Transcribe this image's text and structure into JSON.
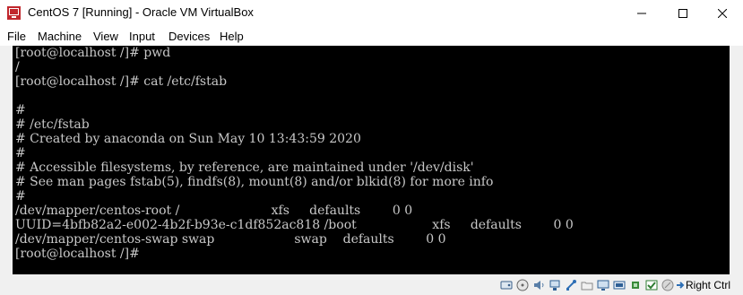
{
  "window": {
    "title": "CentOS 7 [Running] - Oracle VM VirtualBox"
  },
  "menu": [
    "File",
    "Machine",
    "View",
    "Input",
    "Devices",
    "Help"
  ],
  "console_lines": [
    "[root@localhost /]# pwd",
    "/",
    "[root@localhost /]# cat /etc/fstab",
    "",
    "#",
    "# /etc/fstab",
    "# Created by anaconda on Sun May 10 13:43:59 2020",
    "#",
    "# Accessible filesystems, by reference, are maintained under '/dev/disk'",
    "# See man pages fstab(5), findfs(8), mount(8) and/or blkid(8) for more info",
    "#",
    "/dev/mapper/centos-root /                       xfs     defaults        0 0",
    "UUID=4bfb82a2-e002-4b2f-b93e-c1df852ac818 /boot                   xfs     defaults        0 0",
    "/dev/mapper/centos-swap swap                    swap    defaults        0 0",
    "[root@localhost /]#"
  ],
  "status": {
    "host_key": "Right Ctrl",
    "icons": [
      "hard-disk-icon",
      "optical-drive-icon",
      "audio-icon",
      "network-icon",
      "usb-icon",
      "shared-folders-icon",
      "display-icon",
      "recording-icon",
      "cpu-icon",
      "keyboard-capture-icon",
      "mouse-integration-icon",
      "host-key-arrow-icon"
    ]
  },
  "colors": {
    "console_bg": "#000000",
    "console_fg": "#c8c8c8",
    "close_hover": "#e81123"
  }
}
